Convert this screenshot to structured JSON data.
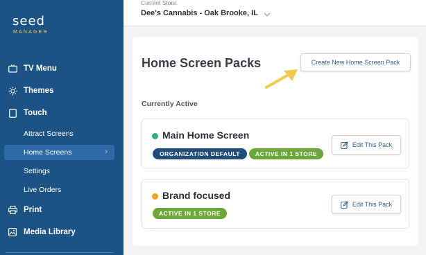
{
  "sidebar": {
    "logo": {
      "word": "seed",
      "subword": "MANAGER"
    },
    "items": [
      {
        "label": "TV Menu",
        "icon": "tv-icon"
      },
      {
        "label": "Themes",
        "icon": "sun-icon"
      },
      {
        "label": "Touch",
        "icon": "tablet-icon"
      },
      {
        "label": "Print",
        "icon": "printer-icon"
      },
      {
        "label": "Media Library",
        "icon": "image-icon"
      }
    ],
    "touch_subitems": [
      {
        "label": "Attract Screens"
      },
      {
        "label": "Home Screens",
        "active": true
      },
      {
        "label": "Settings"
      },
      {
        "label": "Live Orders"
      }
    ]
  },
  "topbar": {
    "caption": "Current Store",
    "store": "Dee's Cannabis - Oak Brooke, IL"
  },
  "main": {
    "title": "Home Screen Packs",
    "create_button": "Create New Home Screen Pack",
    "section_label": "Currently Active",
    "packs": [
      {
        "name": "Main Home Screen",
        "status_color": "#2ab37a",
        "badges": [
          "ORGANIZATION DEFAULT",
          "ACTIVE IN 1 STORE"
        ],
        "edit_label": "Edit This Pack"
      },
      {
        "name": "Brand focused",
        "status_color": "#f0a020",
        "badges": [
          "ACTIVE IN 1 STORE"
        ],
        "edit_label": "Edit This Pack"
      }
    ]
  },
  "colors": {
    "sidebar": "#1c5385",
    "accent": "#f2c94c",
    "badge_dark": "#1f4e7a",
    "badge_green": "#6aa838"
  }
}
